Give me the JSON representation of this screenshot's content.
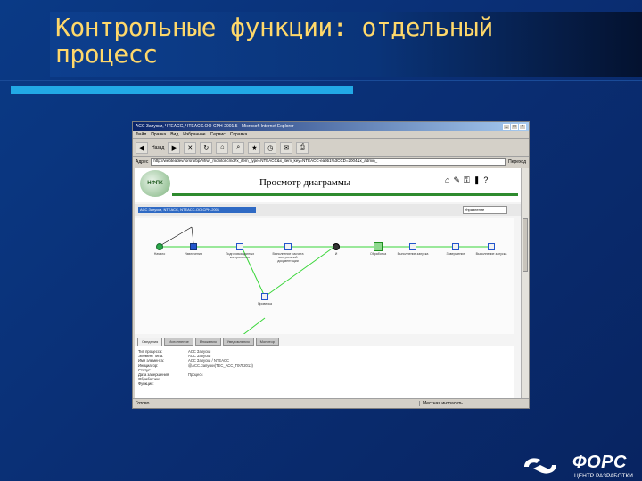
{
  "slide": {
    "title_line1": "Контрольные функции: отдельный",
    "title_line2": "процесс"
  },
  "window": {
    "title": "АСС Запуски, ЧТЕАСС, ЧТЕАСС.ОО-СРН-2001.5 - Microsoft Internet Explorer",
    "menu": [
      "Файл",
      "Правка",
      "Вид",
      "Избранное",
      "Сервис",
      "Справка"
    ],
    "back_label": "Назад",
    "address_label": "Адрес",
    "address": "http://webteadev/forsru/bp/wf/wf_monitor.cmd?x_item_type=NTEACC&x_item_key=NTEACC-ea9b1%3CCD=2004&x_admin_",
    "go_label": "Переход",
    "status": "Готово",
    "zone": "Местная интрасеть"
  },
  "page": {
    "logo_text": "НФПК",
    "heading": "Просмотр диаграммы",
    "breadcrumb": "АСС Запуски, NTEACC, NTEACC-OO-СРН-2001",
    "select_value": "Управление"
  },
  "diagram": {
    "nodes": [
      {
        "label": "Начало"
      },
      {
        "label": "Извлечение"
      },
      {
        "label": "Подготовка данных контрольного"
      },
      {
        "label": "Выполнение расчета контрольной документации"
      },
      {
        "label": "Проверка"
      },
      {
        "label": "И"
      },
      {
        "label": "Обработка"
      },
      {
        "label": "Выполнение запуска"
      },
      {
        "label": "Завершение"
      },
      {
        "label": "Выполнение запуска"
      }
    ]
  },
  "tabs": [
    "Сведения",
    "Исполнение",
    "Вложения",
    "Уведомления",
    "Монитор"
  ],
  "properties": [
    {
      "key": "Тип процесса:",
      "value": "АСС Запуски"
    },
    {
      "key": "Элемент типа:",
      "value": "АСС Запуски"
    },
    {
      "key": "Имя элемента:",
      "value": "АСС Запуски / NTEACC"
    },
    {
      "key": "Инициатор:",
      "value": "@АСС.Запуски(ТЕС_АСС_ПУЛ.2013)"
    },
    {
      "key": "Статус:",
      "value": ""
    },
    {
      "key": "Дата завершения:",
      "value": "Процесс"
    },
    {
      "key": "Обработчик:",
      "value": ""
    },
    {
      "key": "Функция:",
      "value": ""
    }
  ],
  "brand": {
    "name": "ФОРС",
    "subtitle": "ЦЕНТР РАЗРАБОТКИ"
  },
  "colors": {
    "slide_bg": "#0a3a86",
    "title_text": "#ffd86a",
    "accent_bar": "#22a9e6",
    "header_green": "#2e8b2e",
    "diagram_edge": "#39d639"
  }
}
